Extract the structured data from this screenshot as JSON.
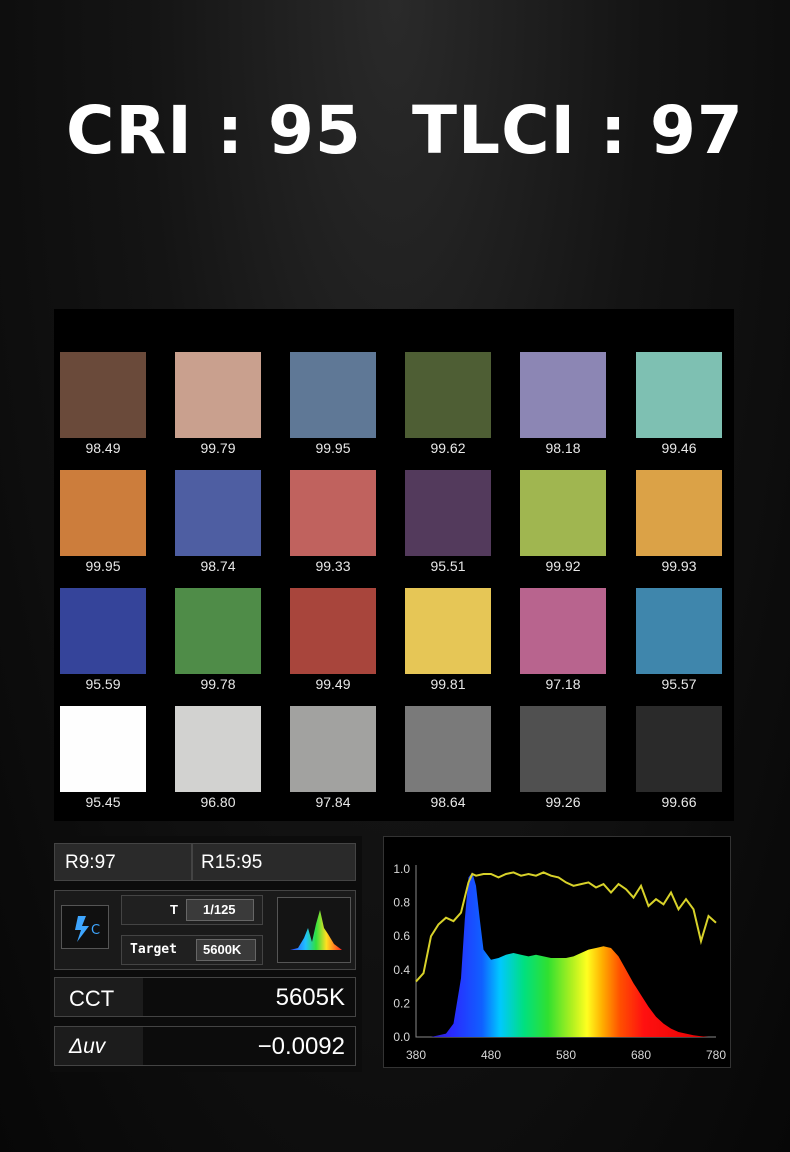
{
  "headline": {
    "cri_label": "CRI :",
    "cri_value": "95",
    "tlci_label": "TLCI :",
    "tlci_value": "97"
  },
  "color_checker": {
    "rows": [
      [
        {
          "color": "#6a4a3a",
          "score": "98.49"
        },
        {
          "color": "#c9a08e",
          "score": "99.79"
        },
        {
          "color": "#5f7896",
          "score": "99.95"
        },
        {
          "color": "#4e5e34",
          "score": "99.62"
        },
        {
          "color": "#8c86b4",
          "score": "98.18"
        },
        {
          "color": "#7ec0b2",
          "score": "99.46"
        }
      ],
      [
        {
          "color": "#cc7d3c",
          "score": "99.95"
        },
        {
          "color": "#4e5ea2",
          "score": "98.74"
        },
        {
          "color": "#c0625e",
          "score": "99.33"
        },
        {
          "color": "#533a5c",
          "score": "95.51"
        },
        {
          "color": "#a0b650",
          "score": "99.92"
        },
        {
          "color": "#dba247",
          "score": "99.93"
        }
      ],
      [
        {
          "color": "#35449a",
          "score": "95.59"
        },
        {
          "color": "#4f8c48",
          "score": "99.78"
        },
        {
          "color": "#a8453c",
          "score": "99.49"
        },
        {
          "color": "#e6c656",
          "score": "99.81"
        },
        {
          "color": "#b8648e",
          "score": "97.18"
        },
        {
          "color": "#3f86ac",
          "score": "95.57"
        }
      ],
      [
        {
          "color": "#fefefe",
          "score": "95.45"
        },
        {
          "color": "#d2d2d0",
          "score": "96.80"
        },
        {
          "color": "#a2a2a0",
          "score": "97.84"
        },
        {
          "color": "#7a7a7a",
          "score": "98.64"
        },
        {
          "color": "#505050",
          "score": "99.26"
        },
        {
          "color": "#2a2a2a",
          "score": "99.66"
        }
      ]
    ]
  },
  "meter": {
    "r9": "R9:97",
    "r15": "R15:95",
    "mode_icon": "flash-c-icon",
    "shutter_label": "T",
    "shutter_value": "1/125",
    "target_label": "Target",
    "target_value": "5600K",
    "spectrum_thumb_icon": "spectrum-thumbnail-icon",
    "cct_label": "CCT",
    "cct_value": "5605K",
    "duv_label": "Δuv",
    "duv_value": "−0.0092"
  },
  "chart_data": {
    "type": "area",
    "x_ticks": [
      "380",
      "480",
      "580",
      "680",
      "780"
    ],
    "y_ticks": [
      "0.0",
      "0.2",
      "0.4",
      "0.6",
      "0.8",
      "1.0"
    ],
    "xlim": [
      380,
      780
    ],
    "ylim": [
      0,
      1.0
    ],
    "series": [
      {
        "kind": "spd-area",
        "x": [
          380,
          400,
          420,
          430,
          440,
          445,
          450,
          455,
          460,
          465,
          470,
          480,
          490,
          500,
          510,
          520,
          530,
          540,
          550,
          560,
          570,
          580,
          590,
          600,
          610,
          620,
          630,
          640,
          650,
          660,
          670,
          680,
          690,
          700,
          710,
          720,
          730,
          740,
          750,
          760,
          770,
          780
        ],
        "y": [
          0.0,
          0.0,
          0.02,
          0.08,
          0.35,
          0.7,
          0.95,
          0.98,
          0.9,
          0.7,
          0.52,
          0.46,
          0.47,
          0.49,
          0.5,
          0.49,
          0.48,
          0.49,
          0.48,
          0.47,
          0.47,
          0.47,
          0.48,
          0.5,
          0.52,
          0.53,
          0.54,
          0.53,
          0.48,
          0.4,
          0.32,
          0.25,
          0.18,
          0.12,
          0.08,
          0.05,
          0.03,
          0.02,
          0.01,
          0.005,
          0.0,
          0.0
        ]
      },
      {
        "kind": "rendering-curve",
        "color": "#d8d22a",
        "x": [
          380,
          390,
          400,
          410,
          420,
          430,
          440,
          450,
          455,
          460,
          470,
          480,
          490,
          500,
          510,
          520,
          530,
          540,
          550,
          560,
          570,
          580,
          590,
          600,
          610,
          620,
          630,
          640,
          650,
          660,
          670,
          680,
          690,
          700,
          710,
          720,
          730,
          740,
          750,
          760,
          770,
          780
        ],
        "y": [
          0.33,
          0.38,
          0.6,
          0.67,
          0.71,
          0.69,
          0.74,
          0.92,
          0.97,
          0.96,
          0.97,
          0.97,
          0.95,
          0.97,
          0.98,
          0.96,
          0.97,
          0.96,
          0.98,
          0.96,
          0.95,
          0.92,
          0.9,
          0.91,
          0.92,
          0.89,
          0.91,
          0.86,
          0.91,
          0.88,
          0.83,
          0.9,
          0.78,
          0.82,
          0.79,
          0.86,
          0.76,
          0.82,
          0.76,
          0.57,
          0.72,
          0.68
        ]
      }
    ]
  }
}
